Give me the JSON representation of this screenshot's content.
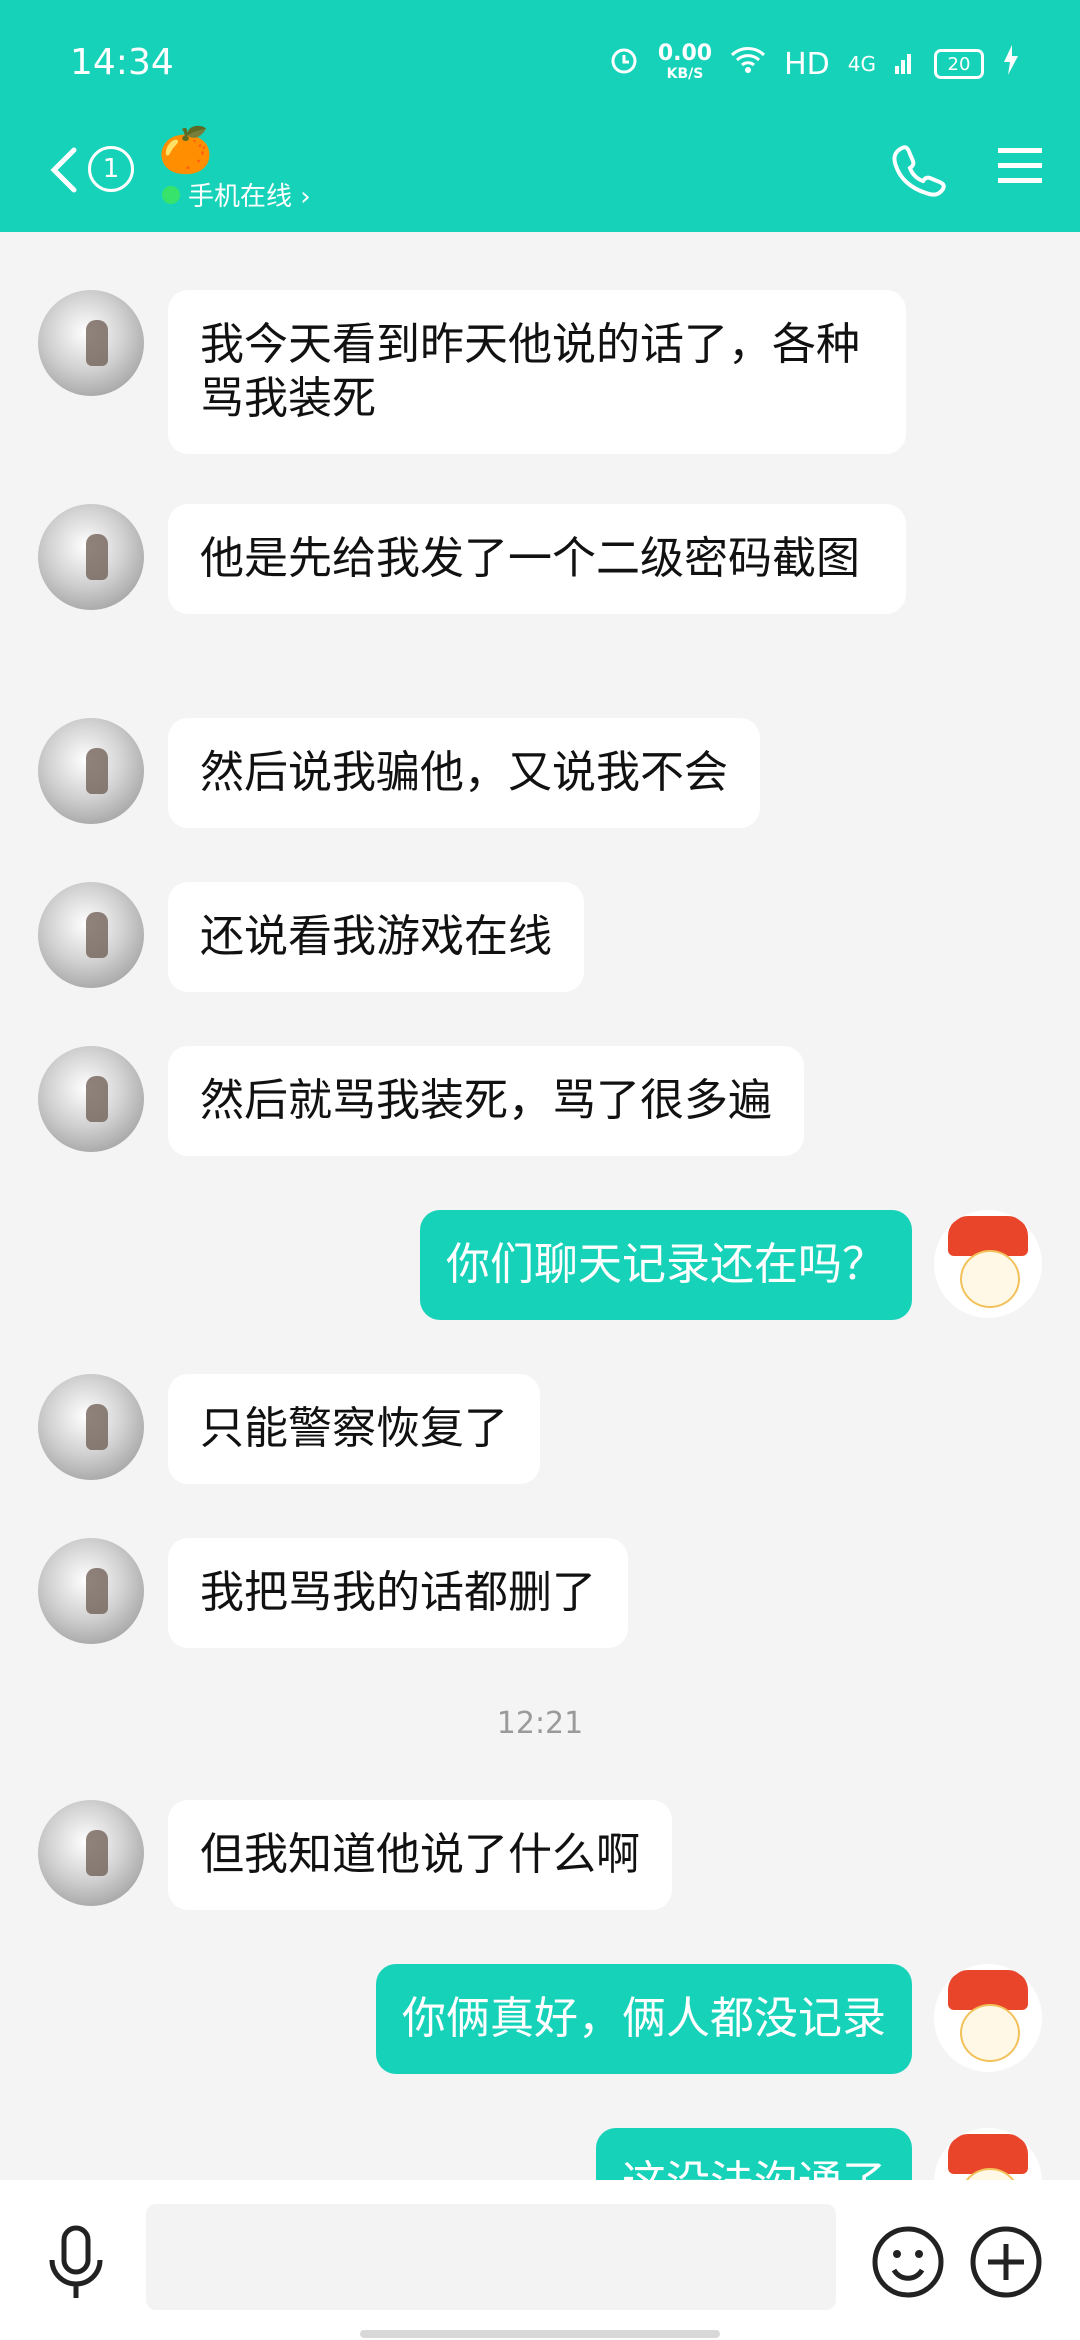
{
  "status_bar": {
    "time": "14:34",
    "net_speed": "0.00",
    "net_unit": "KB/S",
    "hd": "HD",
    "signal": "4G",
    "battery": "20"
  },
  "header": {
    "contact_emoji": "🍊",
    "unread_count": "1",
    "online_status": "手机在线 ›"
  },
  "messages": [
    {
      "side": "left",
      "text": "我今天看到昨天他说的话了，各种骂我装死"
    },
    {
      "side": "left",
      "text": "他是先给我发了一个二级密码截图"
    },
    {
      "side": "left",
      "text": "然后说我骗他，又说我不会"
    },
    {
      "side": "left",
      "text": "还说看我游戏在线"
    },
    {
      "side": "left",
      "text": "然后就骂我装死，骂了很多遍"
    },
    {
      "side": "right",
      "text": "你们聊天记录还在吗？"
    },
    {
      "side": "left",
      "text": "只能警察恢复了"
    },
    {
      "side": "left",
      "text": "我把骂我的话都删了"
    },
    {
      "side": "left",
      "text": "但我知道他说了什么啊"
    },
    {
      "side": "right",
      "text": "你俩真好，俩人都没记录"
    },
    {
      "side": "right",
      "text": "这没法沟通了"
    }
  ],
  "timestamp": "12:21",
  "colors": {
    "accent": "#16d2b8",
    "background": "#f4f4f4",
    "bubble_left": "#ffffff"
  },
  "icons": [
    "back-arrow-icon",
    "phone-icon",
    "menu-icon",
    "microphone-icon",
    "emoji-icon",
    "plus-icon"
  ]
}
